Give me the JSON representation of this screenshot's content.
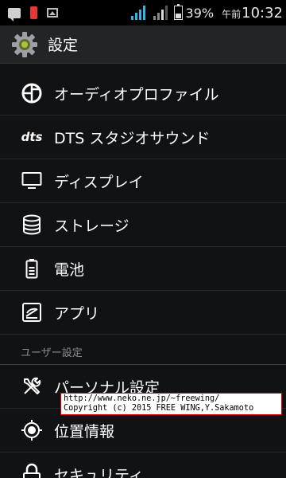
{
  "status_bar": {
    "notification_icons": [
      "chat-icon",
      "phone-icon",
      "image-icon"
    ],
    "battery_percent": "39%",
    "ampm": "午前",
    "time": "10:32",
    "colors": {
      "signal": "#33b5e5",
      "phone": "#e53935"
    }
  },
  "action_bar": {
    "title": "設定",
    "icon": "settings-gear-icon"
  },
  "settings": {
    "items": [
      {
        "label": "オーディオプロファイル",
        "icon": "audio-profile-icon"
      },
      {
        "label": "DTS スタジオサウンド",
        "icon": "dts-icon",
        "icon_text": "dts"
      },
      {
        "label": "ディスプレイ",
        "icon": "display-icon"
      },
      {
        "label": "ストレージ",
        "icon": "storage-icon"
      },
      {
        "label": "電池",
        "icon": "battery-icon"
      },
      {
        "label": "アプリ",
        "icon": "apps-icon"
      }
    ],
    "section_user": "ユーザー設定",
    "user_items": [
      {
        "label": "パーソナル設定",
        "icon": "tools-icon"
      },
      {
        "label": "位置情報",
        "icon": "location-icon"
      },
      {
        "label": "セキュリティ",
        "icon": "lock-icon"
      }
    ]
  },
  "watermark": {
    "line1": "http://www.neko.ne.jp/~freewing/",
    "line2": "Copyright (c) 2015 FREE WING,Y.Sakamoto"
  }
}
